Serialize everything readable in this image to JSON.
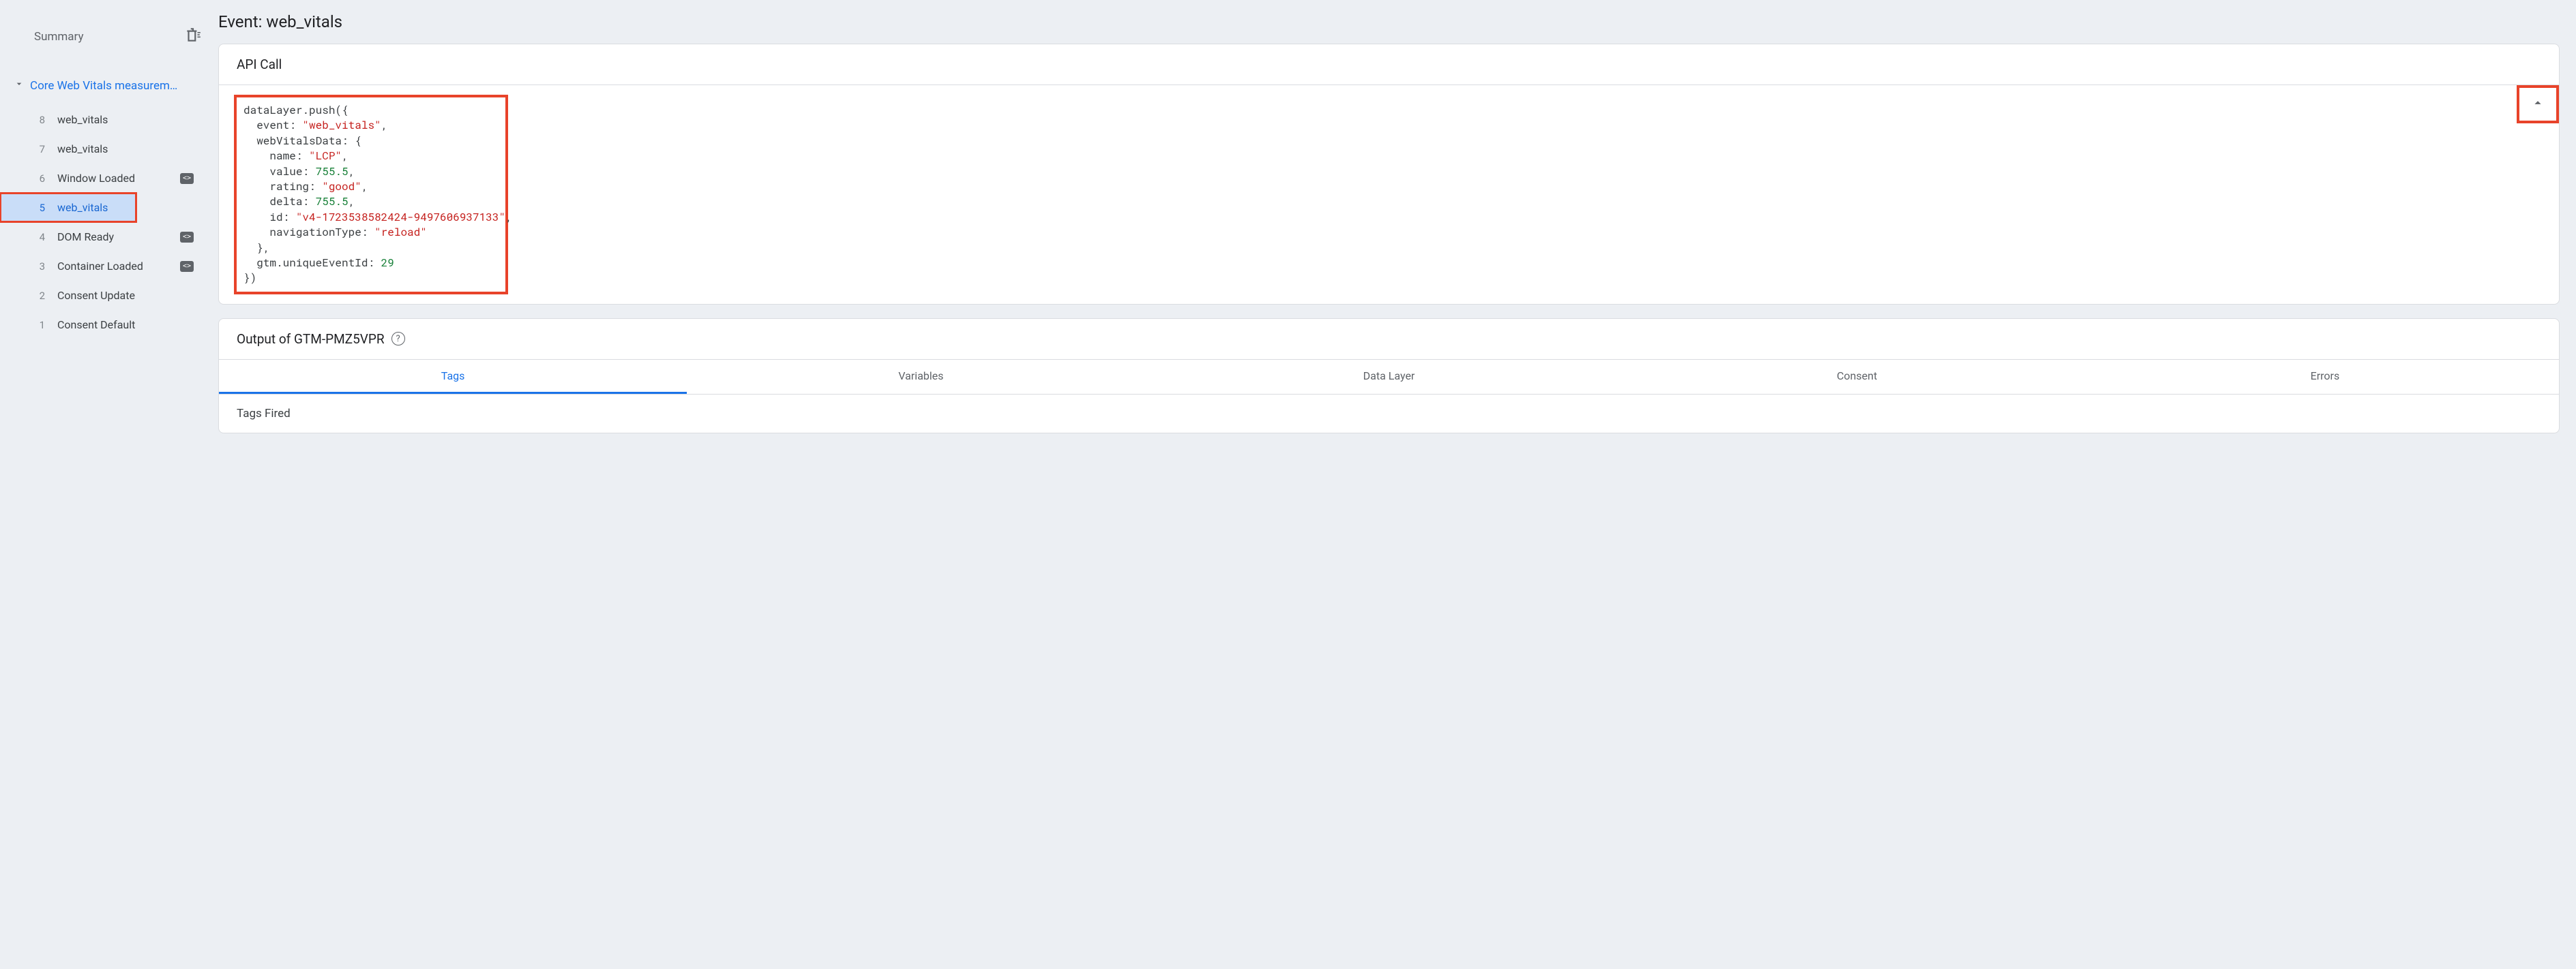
{
  "sidebar": {
    "summary_label": "Summary",
    "group_label": "Core Web Vitals measurem…",
    "events": [
      {
        "num": "8",
        "label": "web_vitals",
        "icon": false
      },
      {
        "num": "7",
        "label": "web_vitals",
        "icon": false
      },
      {
        "num": "6",
        "label": "Window Loaded",
        "icon": true
      },
      {
        "num": "5",
        "label": "web_vitals",
        "icon": false,
        "selected": true,
        "highlight": true
      },
      {
        "num": "4",
        "label": "DOM Ready",
        "icon": true
      },
      {
        "num": "3",
        "label": "Container Loaded",
        "icon": true
      },
      {
        "num": "2",
        "label": "Consent Update",
        "icon": false
      },
      {
        "num": "1",
        "label": "Consent Default",
        "icon": false
      }
    ]
  },
  "page": {
    "title": "Event: web_vitals"
  },
  "api_call": {
    "header": "API Call",
    "code": {
      "fn": "dataLayer.push",
      "event_key": "event",
      "event_val": "\"web_vitals\"",
      "wvd_key": "webVitalsData",
      "name_key": "name",
      "name_val": "\"LCP\"",
      "value_key": "value",
      "value_val": "755.5",
      "rating_key": "rating",
      "rating_val": "\"good\"",
      "delta_key": "delta",
      "delta_val": "755.5",
      "id_key": "id",
      "id_val": "\"v4-1723538582424-9497606937133\"",
      "nav_key": "navigationType",
      "nav_val": "\"reload\"",
      "gtm_key": "gtm.uniqueEventId",
      "gtm_val": "29"
    }
  },
  "output": {
    "header": "Output of GTM-PMZ5VPR",
    "tabs": [
      "Tags",
      "Variables",
      "Data Layer",
      "Consent",
      "Errors"
    ],
    "active_tab": 0,
    "sub_header": "Tags Fired"
  }
}
